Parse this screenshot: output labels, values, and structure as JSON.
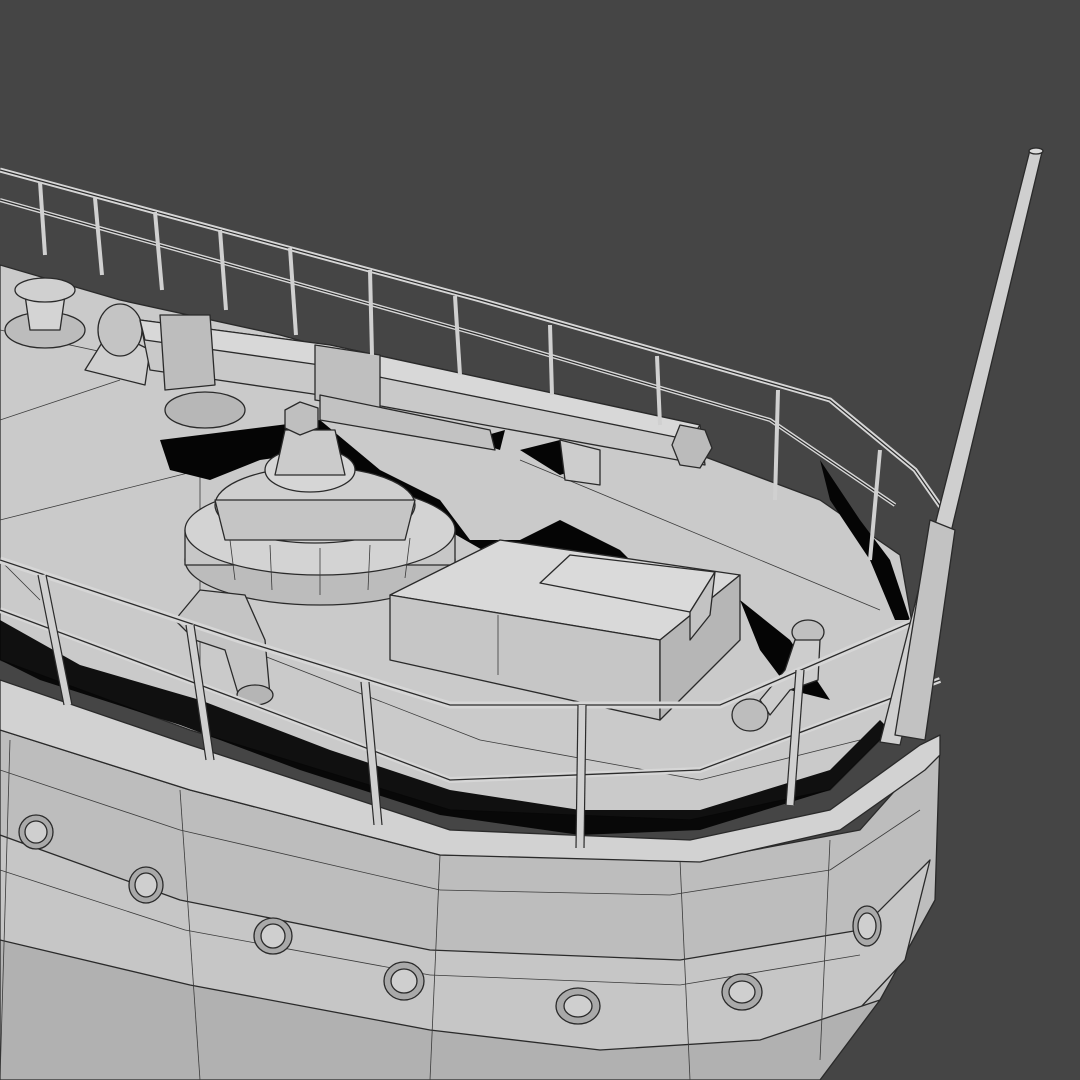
{
  "scene": {
    "background_color": "#454545",
    "surface_color": "#c9c9c9",
    "shadow_color": "#050505",
    "wire_color": "#2a2a2a"
  },
  "objects": [
    "ship-bow-deck",
    "deck-cannon",
    "mooring-bollard",
    "railing",
    "mast",
    "portholes",
    "deck-hatch",
    "ventilator-pipe",
    "capstan"
  ]
}
